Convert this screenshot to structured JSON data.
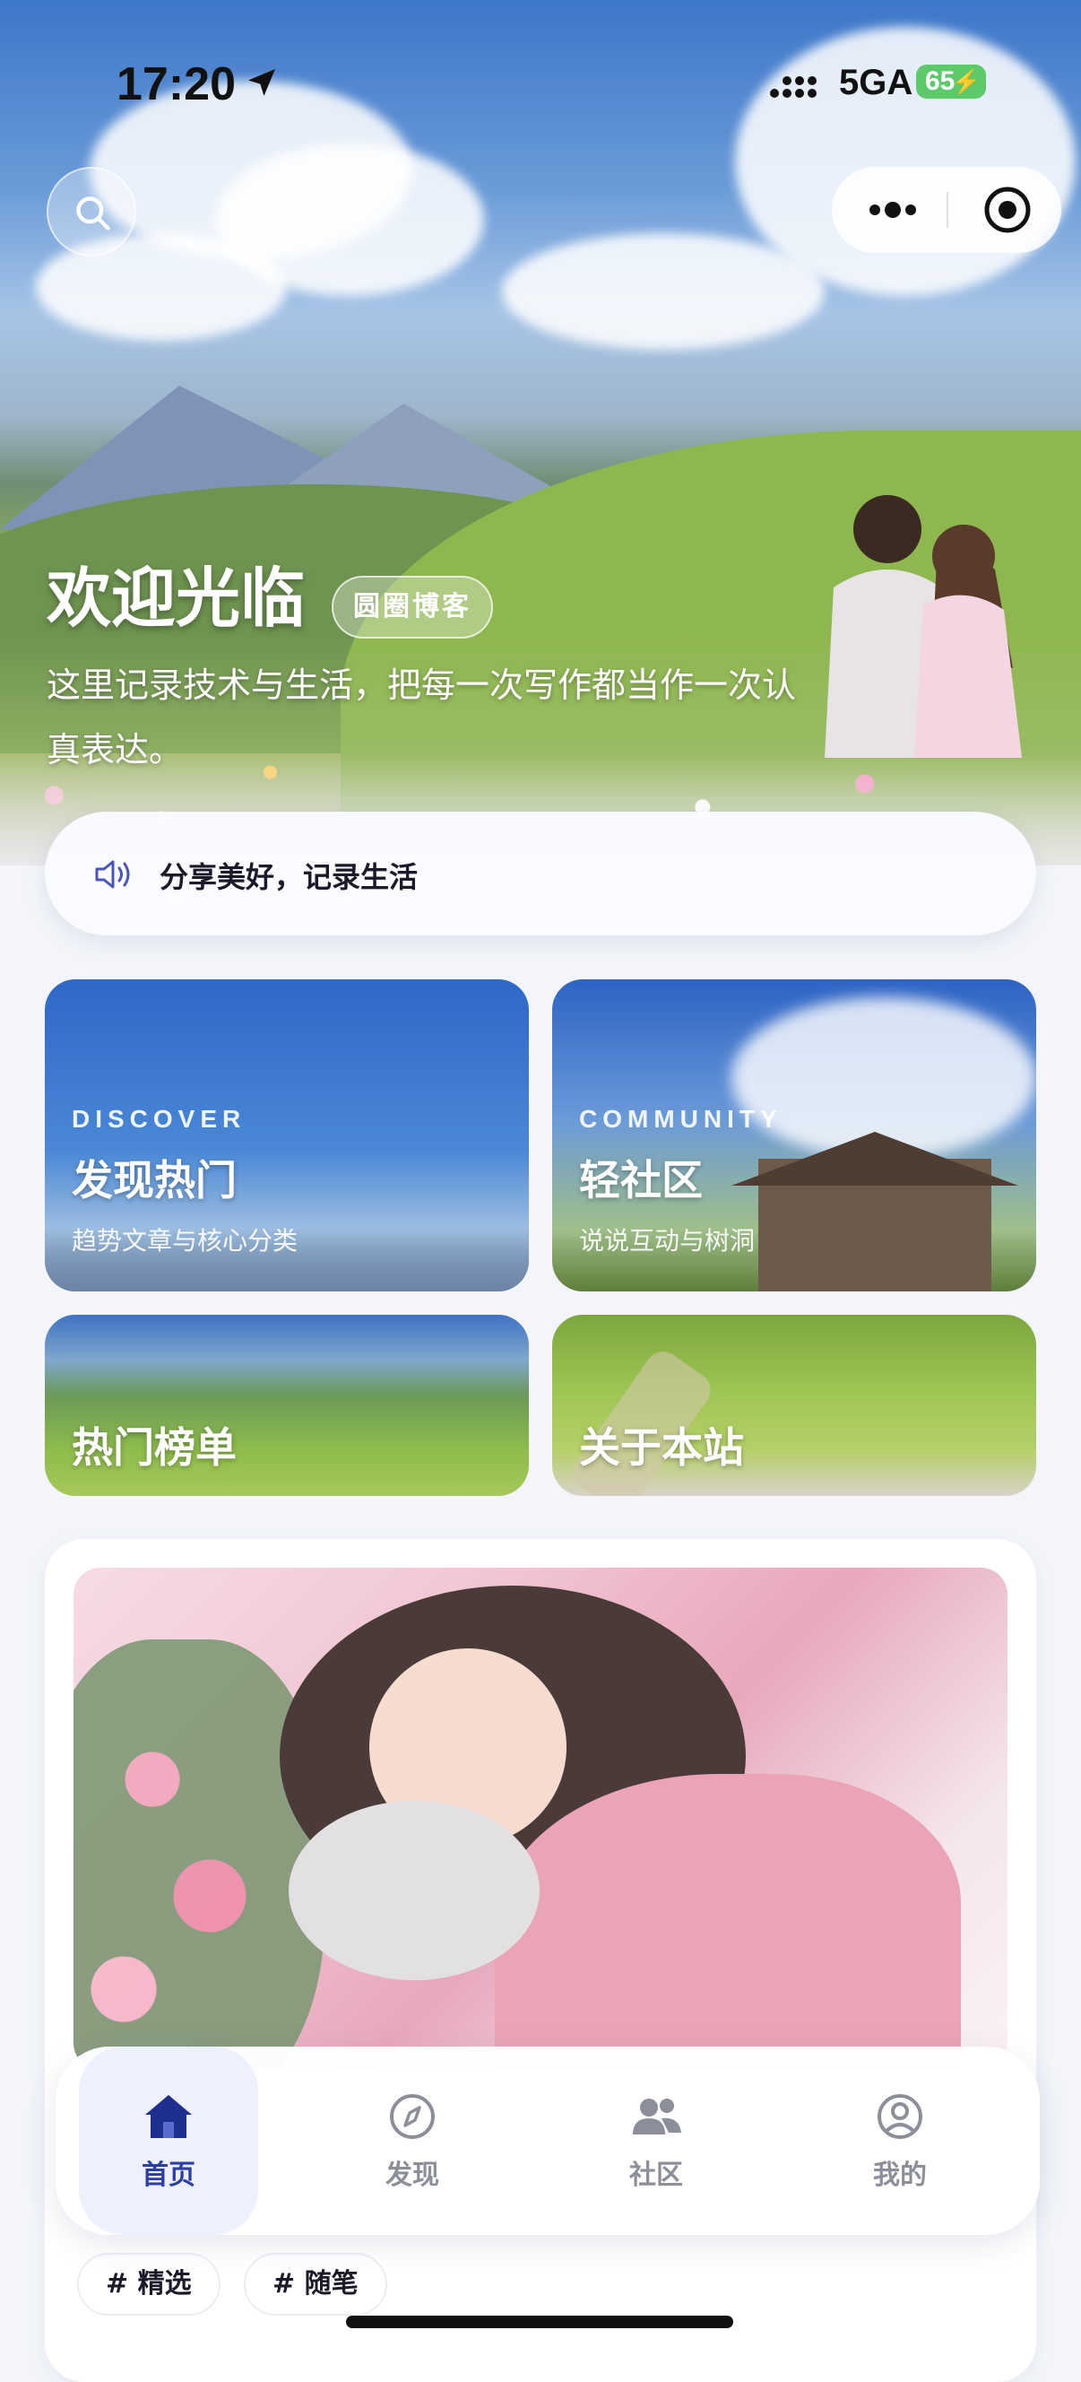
{
  "status_bar": {
    "time": "17:20",
    "network": "5GA",
    "battery": "65"
  },
  "hero": {
    "title": "欢迎光临",
    "badge": "圆圈博客",
    "intro": "这里记录技术与生活，把每一次写作都当作一次认真表达。"
  },
  "notice": {
    "text": "分享美好，记录生活"
  },
  "cards": [
    {
      "en": "DISCOVER",
      "title": "发现热门",
      "subtitle": "趋势文章与核心分类"
    },
    {
      "en": "COMMUNITY",
      "title": "轻社区",
      "subtitle": "说说互动与树洞"
    },
    {
      "title": "热门榜单"
    },
    {
      "title": "关于本站"
    }
  ],
  "tags": [
    "# 精选",
    "# 随笔"
  ],
  "tabbar": {
    "items": [
      {
        "label": "首页",
        "icon": "home-icon",
        "active": true
      },
      {
        "label": "发现",
        "icon": "compass-icon",
        "active": false
      },
      {
        "label": "社区",
        "icon": "users-icon",
        "active": false
      },
      {
        "label": "我的",
        "icon": "profile-icon",
        "active": false
      }
    ]
  },
  "colors": {
    "accent": "#2c3fa6",
    "inactive": "#8c8f99",
    "battery": "#5cc96b"
  }
}
